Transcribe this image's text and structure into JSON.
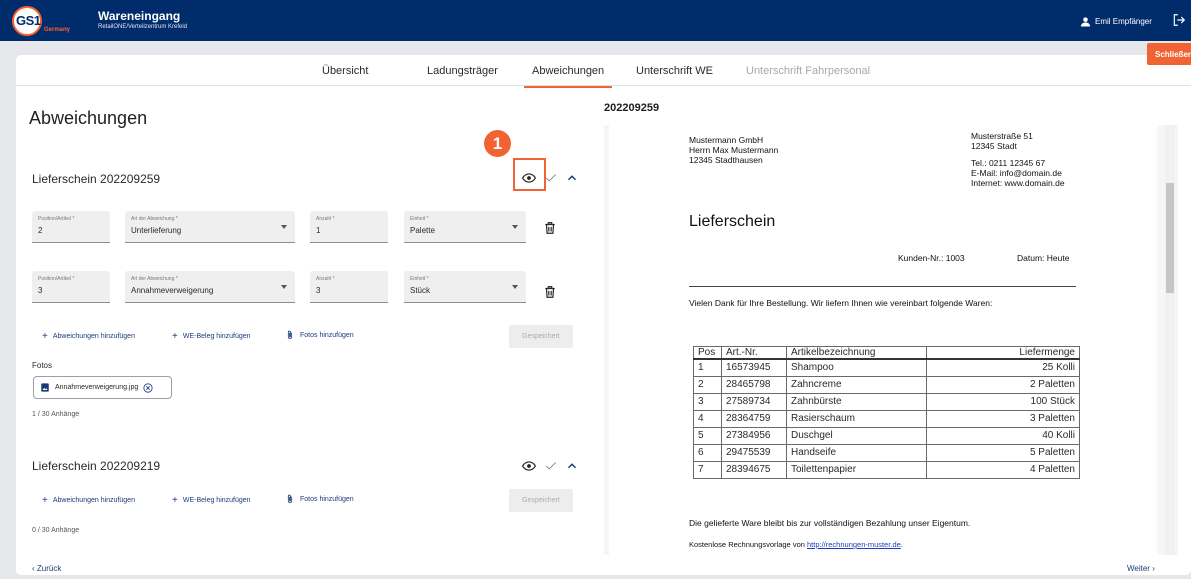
{
  "header": {
    "logo_text": "GS1",
    "logo_country": "Germany",
    "title": "Wareneingang",
    "subtitle": "RetailONE/Verteilzentrum Krefeld",
    "user": "Emil Empfänger",
    "close_label": "Schließen"
  },
  "tabs": [
    {
      "label": "Übersicht"
    },
    {
      "label": "Ladungsträger"
    },
    {
      "label": "Abweichungen"
    },
    {
      "label": "Unterschrift WE"
    },
    {
      "label": "Unterschrift Fahrpersonal"
    }
  ],
  "page_title": "Abweichungen",
  "callout_number": "1",
  "delivery1": {
    "title": "Lieferschein 202209259",
    "rows": [
      {
        "position_label": "Position/Artikel *",
        "position": "2",
        "type_label": "Art der Abweichung *",
        "type": "Unterlieferung",
        "qty_label": "Anzahl *",
        "qty": "1",
        "unit_label": "Einheit *",
        "unit": "Palette"
      },
      {
        "position_label": "Position/Artikel *",
        "position": "3",
        "type_label": "Art der Abweichung *",
        "type": "Annahmeverweigerung",
        "qty_label": "Anzahl *",
        "qty": "3",
        "unit_label": "Einheit *",
        "unit": "Stück"
      }
    ],
    "add_deviation": "Abweichungen hinzufügen",
    "add_receipt": "WE-Beleg hinzufügen",
    "add_photos": "Fotos hinzufügen",
    "saved": "Gespeichert",
    "photos_label": "Fotos",
    "file": "Annahmeverweigerung.jpg",
    "attachments": "1 / 30 Anhänge"
  },
  "delivery2": {
    "title": "Lieferschein 202209219",
    "add_deviation": "Abweichungen hinzufügen",
    "add_receipt": "WE-Beleg hinzufügen",
    "add_photos": "Fotos hinzufügen",
    "saved": "Gespeichert",
    "attachments": "0 / 30 Anhänge"
  },
  "footer": {
    "back": "Zurück",
    "next": "Weiter"
  },
  "document": {
    "number": "202209259",
    "sender": [
      "Mustermann GmbH",
      "Herrn Max Mustermann",
      "12345 Stadthausen"
    ],
    "address": [
      "Musterstraße 51",
      "12345 Stadt"
    ],
    "contact": [
      "Tel.: 0211 12345 67",
      "E-Mail: info@domain.de",
      "Internet: www.domain.de"
    ],
    "heading": "Lieferschein",
    "customer_no": "Kunden-Nr.: 1003",
    "date": "Datum: Heute",
    "intro": "Vielen Dank für Ihre Bestellung. Wir liefern Ihnen wie vereinbart folgende Waren:",
    "table_headers": [
      "Pos",
      "Art.-Nr.",
      "Artikelbezeichnung",
      "Liefermenge"
    ],
    "table_rows": [
      [
        "1",
        "16573945",
        "Shampoo",
        "25 Kolli"
      ],
      [
        "2",
        "28465798",
        "Zahncreme",
        "2 Paletten"
      ],
      [
        "3",
        "27589734",
        "Zahnbürste",
        "100 Stück"
      ],
      [
        "4",
        "28364759",
        "Rasierschaum",
        "3 Paletten"
      ],
      [
        "5",
        "27384956",
        "Duschgel",
        "40 Kolli"
      ],
      [
        "6",
        "29475539",
        "Handseife",
        "5 Paletten"
      ],
      [
        "7",
        "28394675",
        "Toilettenpapier",
        "4 Paletten"
      ]
    ],
    "ownership": "Die gelieferte Ware bleibt bis zur vollständigen Bezahlung unser Eigentum.",
    "footer_text": "Kostenlose Rechnungsvorlage von ",
    "footer_link": "http://rechnungen-muster.de",
    "footer_end": "."
  },
  "colors": {
    "header_bg": "#002c6c",
    "accent": "#f26334",
    "link": "#1b3a7a"
  }
}
